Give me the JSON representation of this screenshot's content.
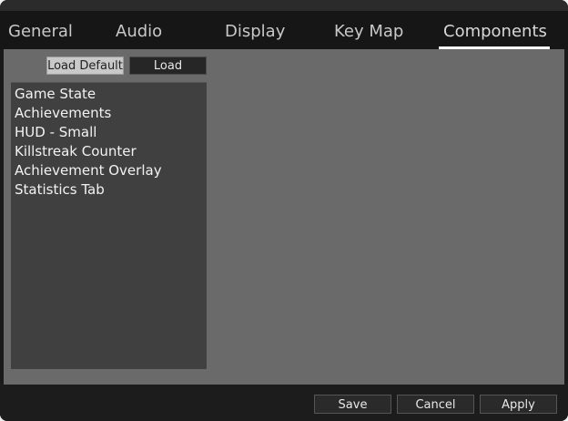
{
  "tabs": [
    {
      "label": "General"
    },
    {
      "label": "Audio"
    },
    {
      "label": "Display"
    },
    {
      "label": "Key Map"
    },
    {
      "label": "Components"
    }
  ],
  "active_tab": "Components",
  "toolbar": {
    "load_default_label": "Load Default",
    "load_label": "Load"
  },
  "components_list": [
    "Game State",
    "Achievements",
    "HUD - Small",
    "Killstreak Counter",
    "Achievement Overlay",
    "Statistics Tab"
  ],
  "footer": {
    "save_label": "Save",
    "cancel_label": "Cancel",
    "apply_label": "Apply"
  }
}
